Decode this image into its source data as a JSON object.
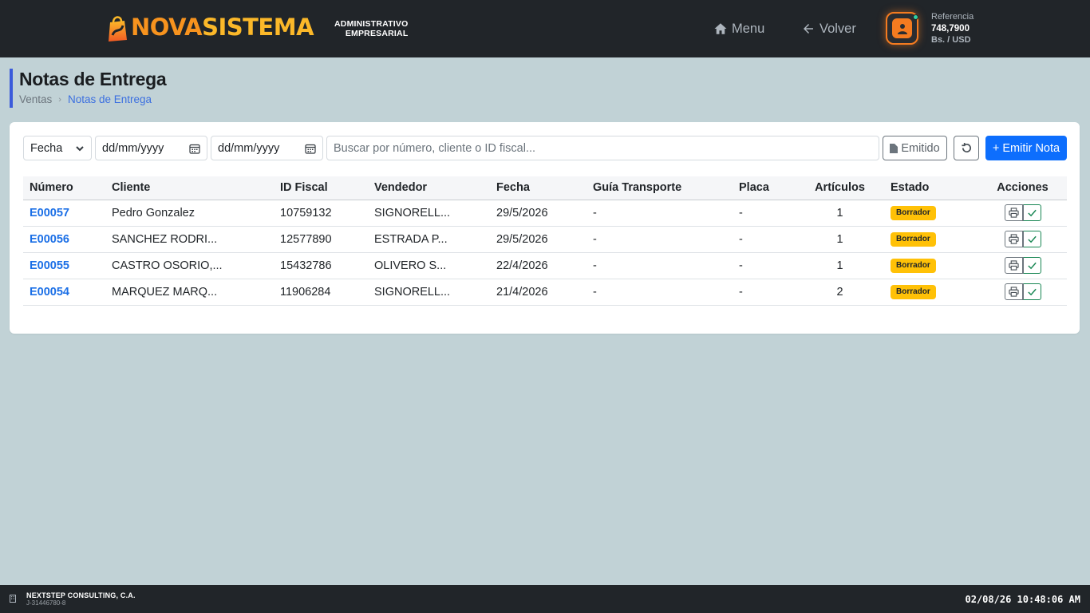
{
  "brand": {
    "name_part1": "NOVA",
    "name_part2": "SISTEMA",
    "subtitle_line1": "ADMINISTRATIVO",
    "subtitle_line2": "EMPRESARIAL"
  },
  "nav": {
    "menu_label": "Menu",
    "back_label": "Volver"
  },
  "reference": {
    "label": "Referencia",
    "value": "748,7900",
    "currency": "Bs. / USD"
  },
  "page": {
    "title": "Notas de Entrega",
    "breadcrumb": [
      "Ventas",
      "Notas de Entrega"
    ]
  },
  "filters": {
    "date_field_select": "Fecha",
    "date_from_placeholder": "dd/mm/yyyy",
    "date_to_placeholder": "dd/mm/yyyy",
    "search_placeholder": "Buscar por número, cliente o ID fiscal...",
    "emitido_label": "Emitido",
    "emitir_label": "+ Emitir Nota"
  },
  "table": {
    "columns": [
      "Número",
      "Cliente",
      "ID Fiscal",
      "Vendedor",
      "Fecha",
      "Guía Transporte",
      "Placa",
      "Artículos",
      "Estado",
      "Acciones"
    ],
    "rows": [
      {
        "numero": "E00057",
        "cliente": "Pedro Gonzalez",
        "id_fiscal": "10759132",
        "vendedor": "SIGNORELL...",
        "fecha": "29/5/2026",
        "guia": "-",
        "placa": "-",
        "articulos": "1",
        "estado": "Borrador"
      },
      {
        "numero": "E00056",
        "cliente": "SANCHEZ RODRI...",
        "id_fiscal": "12577890",
        "vendedor": "ESTRADA P...",
        "fecha": "29/5/2026",
        "guia": "-",
        "placa": "-",
        "articulos": "1",
        "estado": "Borrador"
      },
      {
        "numero": "E00055",
        "cliente": "CASTRO OSORIO,...",
        "id_fiscal": "15432786",
        "vendedor": "OLIVERO S...",
        "fecha": "22/4/2026",
        "guia": "-",
        "placa": "-",
        "articulos": "1",
        "estado": "Borrador"
      },
      {
        "numero": "E00054",
        "cliente": "MARQUEZ MARQ...",
        "id_fiscal": "11906284",
        "vendedor": "SIGNORELL...",
        "fecha": "21/4/2026",
        "guia": "-",
        "placa": "-",
        "articulos": "2",
        "estado": "Borrador"
      }
    ]
  },
  "footer": {
    "company": "NEXTSTEP CONSULTING, C.A.",
    "rif": "J-31446780-8",
    "clock": "02/08/26 10:48:06 AM"
  },
  "colors": {
    "topbar": "#212529",
    "accent_orange": "#f47b20",
    "primary_blue": "#0d6efd",
    "badge_yellow": "#ffc107",
    "page_bg": "#c1d2d6"
  },
  "icons": [
    "brand-bag-icon",
    "home-icon",
    "arrow-left-icon",
    "user-icon",
    "chevron-down-icon",
    "calendar-icon",
    "file-icon",
    "undo-icon",
    "printer-icon",
    "check-icon",
    "building-icon"
  ]
}
